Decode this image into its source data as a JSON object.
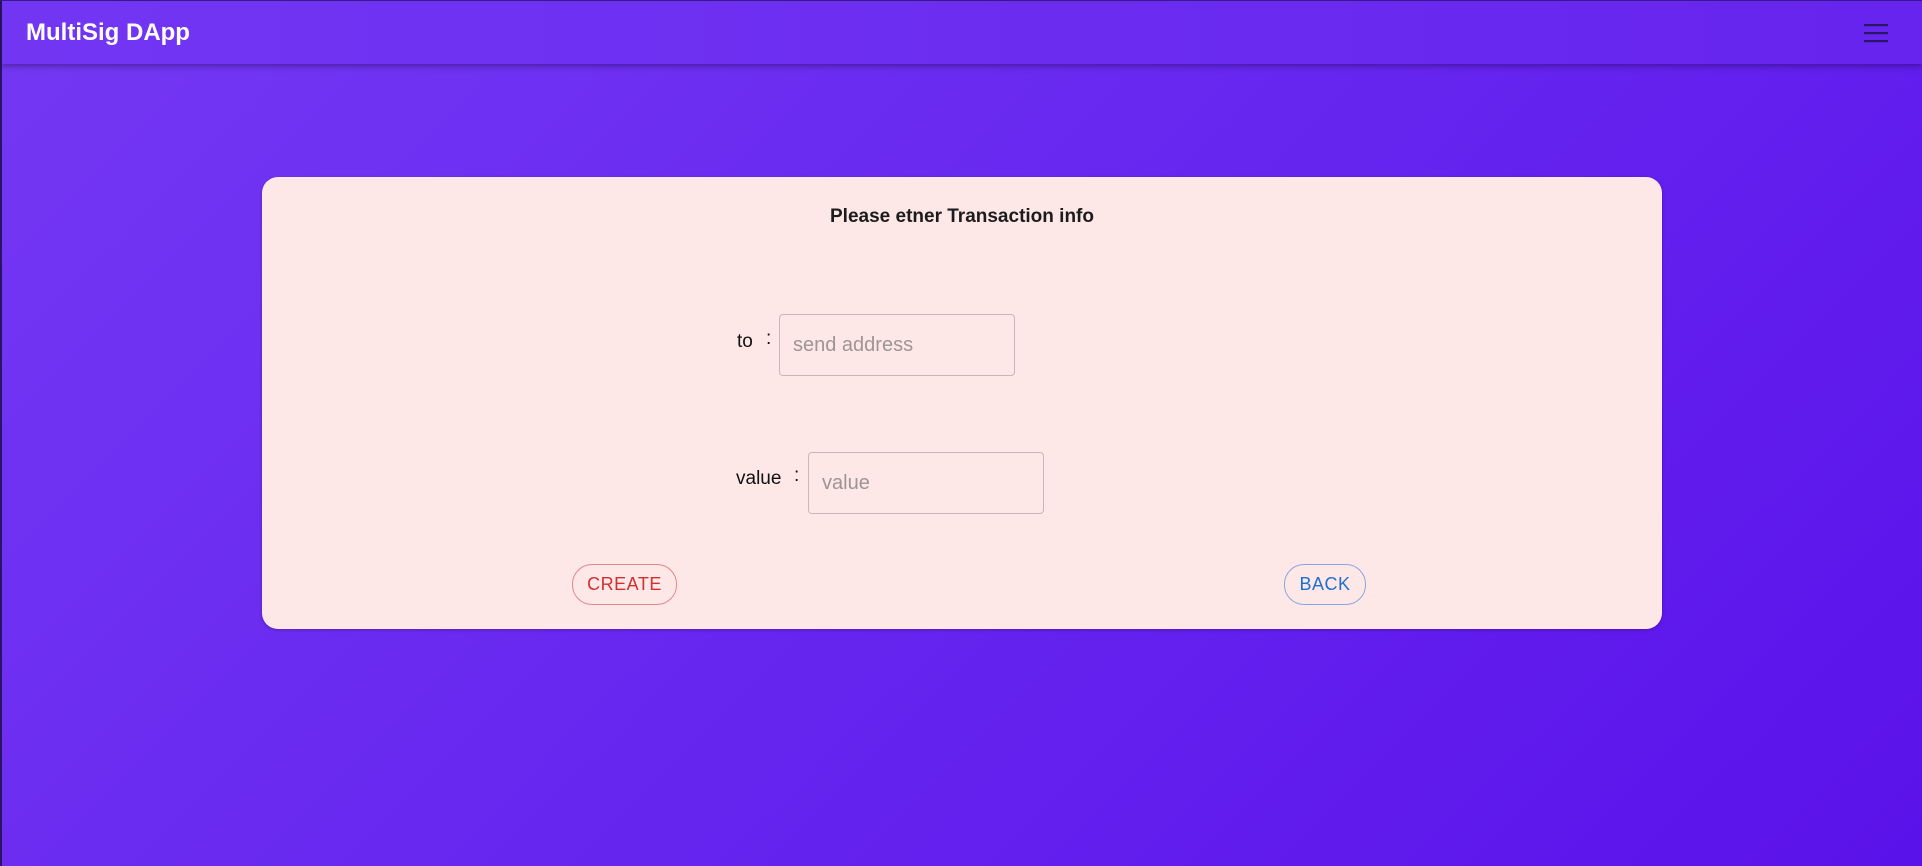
{
  "app_bar": {
    "title": "MultiSig DApp",
    "menu_icon": "hamburger-menu-icon"
  },
  "form": {
    "title": "Please etner Transaction info",
    "to": {
      "label": "to",
      "separator": ":",
      "placeholder": "send address",
      "value": ""
    },
    "value": {
      "label": "value",
      "separator": ":",
      "placeholder": "value",
      "value": ""
    },
    "create_label": "CREATE",
    "back_label": "BACK"
  },
  "colors": {
    "background_gradient_start": "#7438f3",
    "background_gradient_end": "#5a12ea",
    "card_background": "#fde8e7",
    "create_button": "#d32f2f",
    "back_button": "#1e6fd0"
  }
}
